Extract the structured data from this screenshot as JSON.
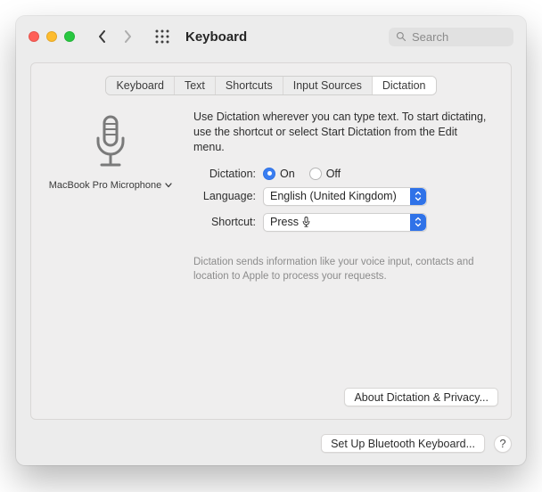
{
  "titlebar": {
    "title": "Keyboard",
    "search_placeholder": "Search"
  },
  "tabs": [
    "Keyboard",
    "Text",
    "Shortcuts",
    "Input Sources",
    "Dictation"
  ],
  "active_tab_index": 4,
  "mic": {
    "label": "MacBook Pro Microphone"
  },
  "description": "Use Dictation wherever you can type text. To start dictating, use the shortcut or select Start Dictation from the Edit menu.",
  "form": {
    "dictation_label": "Dictation:",
    "language_label": "Language:",
    "shortcut_label": "Shortcut:",
    "on_label": "On",
    "off_label": "Off",
    "dictation_state": "on",
    "language_value": "English (United Kingdom)",
    "shortcut_value": "Press "
  },
  "privacy_note": "Dictation sends information like your voice input, contacts and location to Apple to process your requests.",
  "buttons": {
    "about": "About Dictation & Privacy...",
    "bluetooth": "Set Up Bluetooth Keyboard...",
    "help": "?"
  }
}
